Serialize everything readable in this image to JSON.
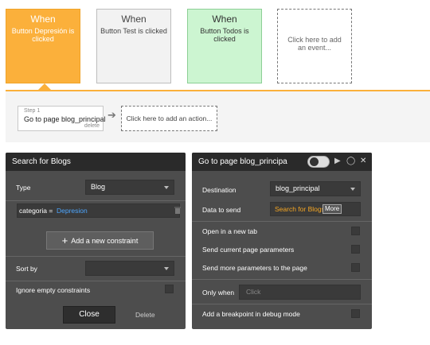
{
  "events": [
    {
      "when": "When",
      "desc": "Button Depresión is clicked",
      "color": "#fbb03b"
    },
    {
      "when": "When",
      "desc": "Button Test is clicked",
      "color": "#f2f2f2"
    },
    {
      "when": "When",
      "desc": "Button Todos is clicked",
      "color": "#ccf5d1"
    },
    {
      "desc": "Click here to add an event..."
    }
  ],
  "workflow": {
    "step": {
      "number": "Step 1",
      "title": "Go to page blog_principal",
      "delete": "delete"
    },
    "add_action": "Click here to add an action..."
  },
  "search_panel": {
    "title": "Search for Blogs",
    "type_label": "Type",
    "type_value": "Blog",
    "constraint": {
      "field": "categoria =",
      "value": "Depresion"
    },
    "add_constraint": "Add a new constraint",
    "sort_label": "Sort by",
    "ignore_label": "Ignore empty constraints",
    "close": "Close",
    "delete": "Delete"
  },
  "action_panel": {
    "title": "Go to page blog_principa",
    "destination_label": "Destination",
    "destination_value": "blog_principal",
    "data_label": "Data to send",
    "data_value": "Search for Blogs",
    "data_more": "More",
    "new_tab": "Open in a new tab",
    "send_current": "Send current page parameters",
    "send_more": "Send more parameters to the page",
    "only_when": "Only when",
    "only_when_placeholder": "Click",
    "breakpoint": "Add a breakpoint in debug mode"
  },
  "colors": {
    "accent": "#fbb03b",
    "link": "#4da6ff",
    "dynamic": "#f5a623"
  }
}
